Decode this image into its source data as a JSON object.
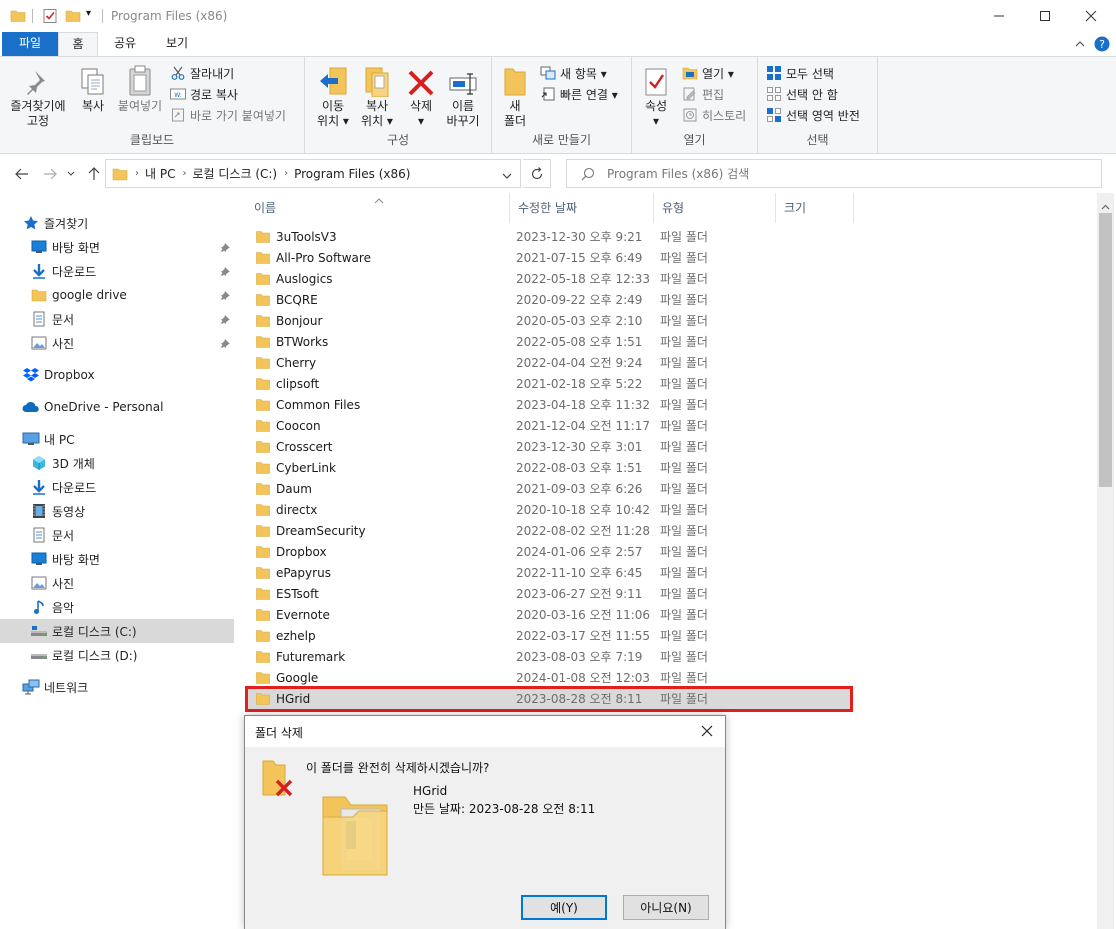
{
  "window": {
    "title": "Program Files (x86)",
    "qa_dropdown": "▾"
  },
  "tabs": [
    "파일",
    "홈",
    "공유",
    "보기"
  ],
  "ribbon": {
    "clipboard": {
      "pin": "즐겨찾기에\n고정",
      "copy": "복사",
      "paste": "붙여넣기",
      "cut": "잘라내기",
      "copy_path": "경로 복사",
      "paste_shortcut": "바로 가기 붙여넣기",
      "label": "클립보드"
    },
    "organize": {
      "move_to": "이동\n위치 ▾",
      "copy_to": "복사\n위치 ▾",
      "delete": "삭제\n▾",
      "rename": "이름\n바꾸기",
      "label": "구성"
    },
    "new": {
      "new_folder": "새\n폴더",
      "new_item": "새 항목 ▾",
      "easy_access": "빠른 연결 ▾",
      "label": "새로 만들기"
    },
    "open": {
      "properties": "속성\n▾",
      "open": "열기 ▾",
      "edit": "편집",
      "history": "히스토리",
      "label": "열기"
    },
    "select": {
      "select_all": "모두 선택",
      "select_none": "선택 안 함",
      "invert": "선택 영역 반전",
      "label": "선택"
    }
  },
  "address": {
    "crumbs": [
      "내 PC",
      "로컬 디스크 (C:)",
      "Program Files (x86)"
    ],
    "search_placeholder": "Program Files (x86) 검색"
  },
  "nav": {
    "quick_access": "즐겨찾기",
    "quick_items": [
      "바탕 화면",
      "다운로드",
      "google drive",
      "문서",
      "사진"
    ],
    "dropbox": "Dropbox",
    "onedrive": "OneDrive - Personal",
    "this_pc": "내 PC",
    "pc_items": [
      "3D 개체",
      "다운로드",
      "동영상",
      "문서",
      "바탕 화면",
      "사진",
      "음악",
      "로컬 디스크 (C:)",
      "로컬 디스크 (D:)"
    ],
    "network": "네트워크"
  },
  "columns": {
    "name": "이름",
    "date": "수정한 날짜",
    "type": "유형",
    "size": "크기"
  },
  "files": [
    {
      "name": "3uToolsV3",
      "date": "2023-12-30 오후 9:21",
      "type": "파일 폴더"
    },
    {
      "name": "All-Pro Software",
      "date": "2021-07-15 오후 6:49",
      "type": "파일 폴더"
    },
    {
      "name": "Auslogics",
      "date": "2022-05-18 오후 12:33",
      "type": "파일 폴더"
    },
    {
      "name": "BCQRE",
      "date": "2020-09-22 오후 2:49",
      "type": "파일 폴더"
    },
    {
      "name": "Bonjour",
      "date": "2020-05-03 오후 2:10",
      "type": "파일 폴더"
    },
    {
      "name": "BTWorks",
      "date": "2022-05-08 오후 1:51",
      "type": "파일 폴더"
    },
    {
      "name": "Cherry",
      "date": "2022-04-04 오전 9:24",
      "type": "파일 폴더"
    },
    {
      "name": "clipsoft",
      "date": "2021-02-18 오후 5:22",
      "type": "파일 폴더"
    },
    {
      "name": "Common Files",
      "date": "2023-04-18 오후 11:32",
      "type": "파일 폴더"
    },
    {
      "name": "Coocon",
      "date": "2021-12-04 오전 11:17",
      "type": "파일 폴더"
    },
    {
      "name": "Crosscert",
      "date": "2023-12-30 오후 3:01",
      "type": "파일 폴더"
    },
    {
      "name": "CyberLink",
      "date": "2022-08-03 오후 1:51",
      "type": "파일 폴더"
    },
    {
      "name": "Daum",
      "date": "2021-09-03 오후 6:26",
      "type": "파일 폴더"
    },
    {
      "name": "directx",
      "date": "2020-10-18 오후 10:42",
      "type": "파일 폴더"
    },
    {
      "name": "DreamSecurity",
      "date": "2022-08-02 오전 11:28",
      "type": "파일 폴더"
    },
    {
      "name": "Dropbox",
      "date": "2024-01-06 오후 2:57",
      "type": "파일 폴더"
    },
    {
      "name": "ePapyrus",
      "date": "2022-11-10 오후 6:45",
      "type": "파일 폴더"
    },
    {
      "name": "ESTsoft",
      "date": "2023-06-27 오전 9:11",
      "type": "파일 폴더"
    },
    {
      "name": "Evernote",
      "date": "2020-03-16 오전 11:06",
      "type": "파일 폴더"
    },
    {
      "name": "ezhelp",
      "date": "2022-03-17 오전 11:55",
      "type": "파일 폴더"
    },
    {
      "name": "Futuremark",
      "date": "2023-08-03 오후 7:19",
      "type": "파일 폴더"
    },
    {
      "name": "Google",
      "date": "2024-01-08 오전 12:03",
      "type": "파일 폴더"
    },
    {
      "name": "HGrid",
      "date": "2023-08-28 오전 8:11",
      "type": "파일 폴더"
    }
  ],
  "dialog": {
    "title": "폴더 삭제",
    "question": "이 폴더를 완전히 삭제하시겠습니까?",
    "folder_name": "HGrid",
    "created": "만든 날짜: 2023-08-28 오전 8:11",
    "yes": "예(Y)",
    "no": "아니요(N)"
  },
  "colors": {
    "file_tab": "#1a6fc9",
    "folder": "#f2c45a",
    "highlight_box": "#e02020",
    "delete_red": "#d42020"
  }
}
